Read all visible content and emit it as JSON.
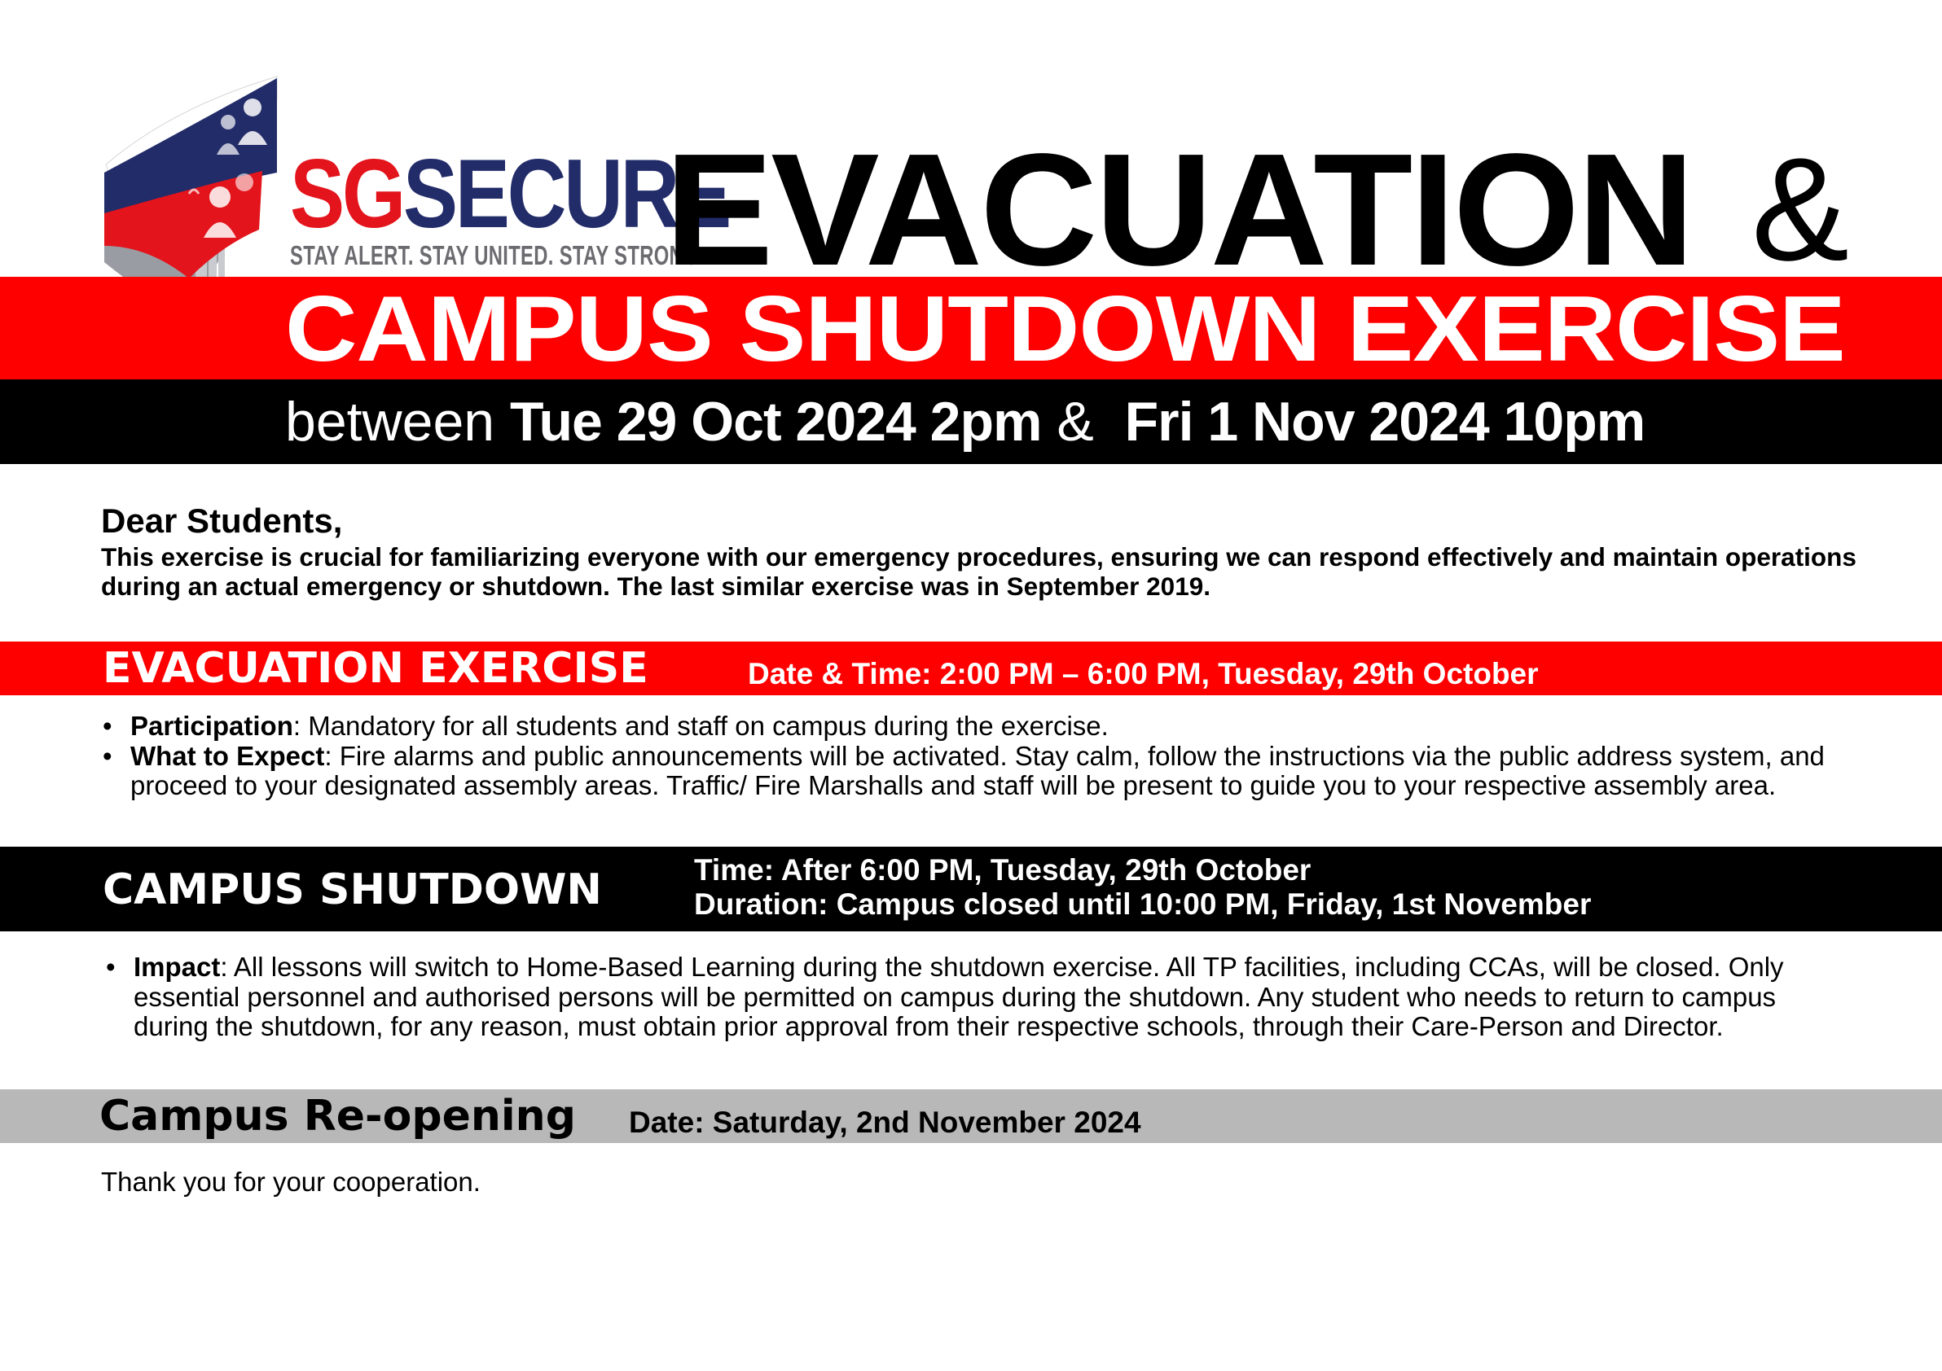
{
  "logo": {
    "brand_sg": "SG",
    "brand_secure": "SECURE",
    "tagline": "STAY ALERT. STAY UNITED. STAY STRONG."
  },
  "headline": {
    "line1": "EVACUATION",
    "ampersand": "&",
    "line2": "CAMPUS SHUTDOWN EXERCISE",
    "date_prefix": "between",
    "date_start": "Tue 29 Oct 2024 2pm",
    "date_joiner": "&",
    "date_end": "Fri 1 Nov 2024 10pm"
  },
  "intro": {
    "greeting": "Dear Students,",
    "body": "This exercise is crucial for familiarizing everyone with our emergency procedures, ensuring we can respond effectively and maintain operations during an actual emergency or shutdown. The last similar exercise was in September 2019."
  },
  "evacuation": {
    "title": "EVACUATION EXERCISE",
    "datetime": "Date & Time: 2:00 PM – 6:00 PM, Tuesday, 29th October",
    "items": [
      {
        "label": "Participation",
        "text": ": Mandatory for all students and staff on campus during the exercise."
      },
      {
        "label": "What to Expect",
        "text": ": Fire alarms and public announcements will be activated. Stay calm, follow the instructions via the public address system, and proceed to your designated assembly areas. Traffic/ Fire Marshalls and staff will be present to guide you to your respective assembly area."
      }
    ]
  },
  "shutdown": {
    "title": "CAMPUS SHUTDOWN",
    "time": "Time: After 6:00 PM, Tuesday, 29th October",
    "duration": "Duration: Campus closed until 10:00 PM, Friday, 1st November",
    "items": [
      {
        "label": "Impact",
        "text": ": All lessons will switch to Home-Based Learning during the shutdown exercise. All TP facilities, including CCAs, will be closed. Only essential personnel and authorised persons will be permitted on campus during the shutdown. Any student who needs to return to campus during the shutdown, for any reason, must obtain prior approval from their respective schools, through their Care-Person and Director."
      }
    ]
  },
  "reopening": {
    "title": "Campus Re-opening",
    "date": "Date: Saturday, 2nd November 2024"
  },
  "closing": "Thank you for your cooperation.",
  "colors": {
    "red": "#ff0000",
    "black": "#000000",
    "grey_bar": "#b8b8b8",
    "brand_red": "#e3141c",
    "brand_navy": "#222c69"
  }
}
